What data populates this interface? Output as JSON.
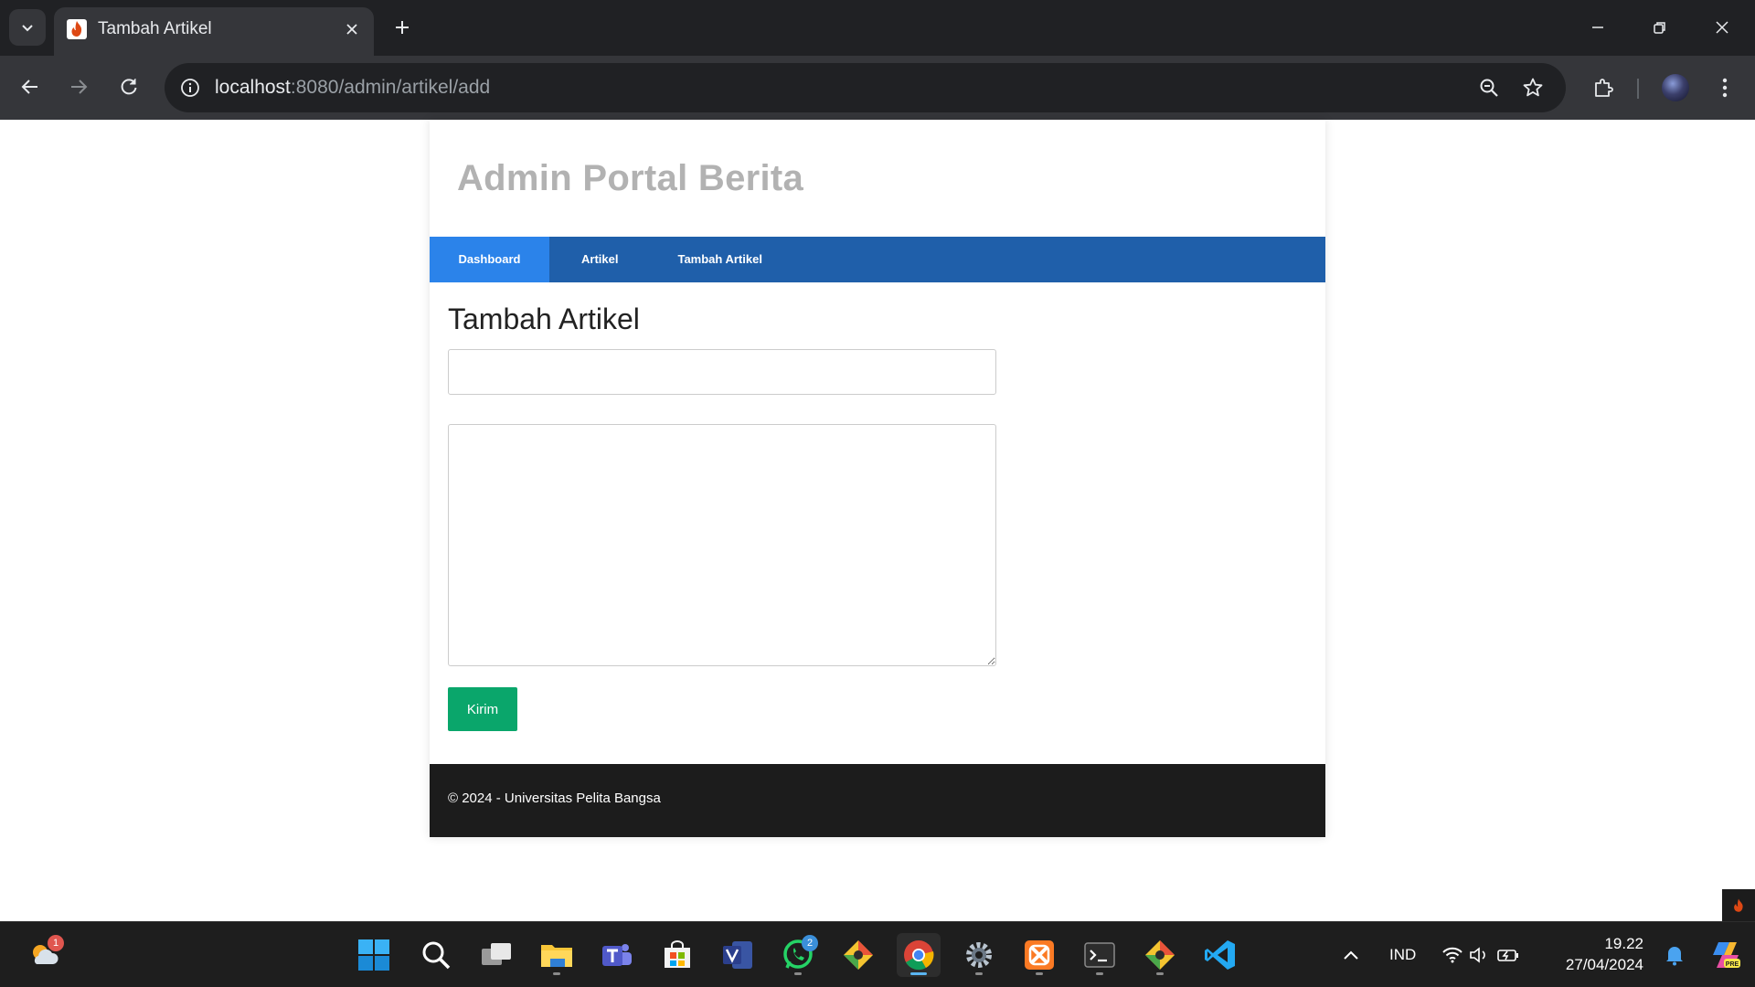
{
  "browser": {
    "tab_title": "Tambah Artikel",
    "url_host": "localhost",
    "url_path": ":8080/admin/artikel/add"
  },
  "site": {
    "title": "Admin Portal Berita",
    "nav": [
      {
        "label": "Dashboard",
        "active": true
      },
      {
        "label": "Artikel",
        "active": false
      },
      {
        "label": "Tambah Artikel",
        "active": false
      }
    ]
  },
  "form": {
    "heading": "Tambah Artikel",
    "title_value": "",
    "body_value": "",
    "submit_label": "Kirim"
  },
  "footer": {
    "text": "© 2024 - Universitas Pelita Bangsa"
  },
  "taskbar": {
    "weather_badge": "1",
    "whatsapp_badge": "2",
    "language": "IND",
    "time": "19.22",
    "date": "27/04/2024"
  },
  "colors": {
    "navbar": "#1f5faa",
    "nav_active": "#2b83ea",
    "submit": "#0aa66b",
    "footer": "#1c1c1c"
  }
}
